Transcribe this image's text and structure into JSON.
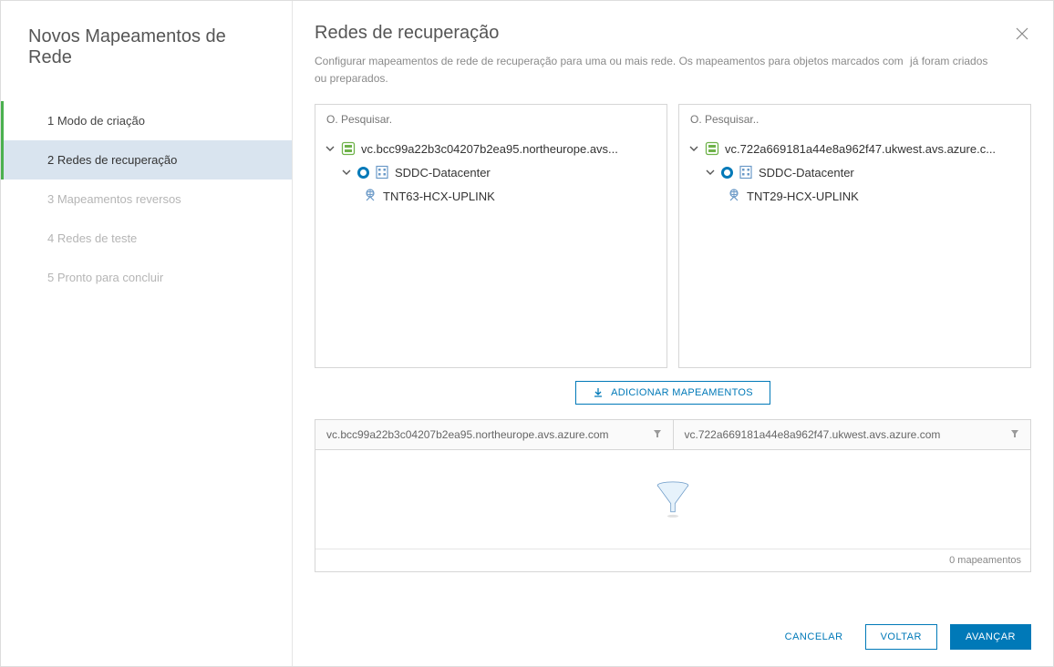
{
  "sidebar": {
    "title": "Novos Mapeamentos de Rede",
    "steps": [
      {
        "label": "1  Modo de criação"
      },
      {
        "label": "2 Redes de recuperação"
      },
      {
        "label": "3 Mapeamentos reversos"
      },
      {
        "label": "4 Redes de teste"
      },
      {
        "label": "5 Pronto para concluir"
      }
    ]
  },
  "main": {
    "title": "Redes de recuperação",
    "subtitle_a": "Configurar mapeamentos de rede de recuperação para uma ou mais rede. Os mapeamentos para objetos marcados com",
    "subtitle_b": "já foram criados",
    "subtitle_c": "ou preparados."
  },
  "left_tree": {
    "search_placeholder": "O. Pesquisar.",
    "root": "vc.bcc99a22b3c04207b2ea95.northeurope.avs...",
    "datacenter": "SDDC-Datacenter",
    "network": "TNT63-HCX-UPLINK"
  },
  "right_tree": {
    "search_placeholder": "O. Pesquisar..",
    "root": "vc.722a669181a44e8a962f47.ukwest.avs.azure.c...",
    "datacenter": "SDDC-Datacenter",
    "network": "TNT29-HCX-UPLINK"
  },
  "add_mapping_label": "ADICIONAR MAPEAMENTOS",
  "table": {
    "col1": "vc.bcc99a22b3c04207b2ea95.northeurope.avs.azure.com",
    "col2": "vc.722a669181a44e8a962f47.ukwest.avs.azure.com",
    "footer": "0 mapeamentos"
  },
  "buttons": {
    "cancel": "CANCELAR",
    "back": "VOLTAR",
    "next": "AVANÇAR"
  },
  "icons": {
    "vcenter_color": "#6fb24a",
    "datacenter_color": "#6a99c7",
    "network_color": "#6a99c7"
  }
}
